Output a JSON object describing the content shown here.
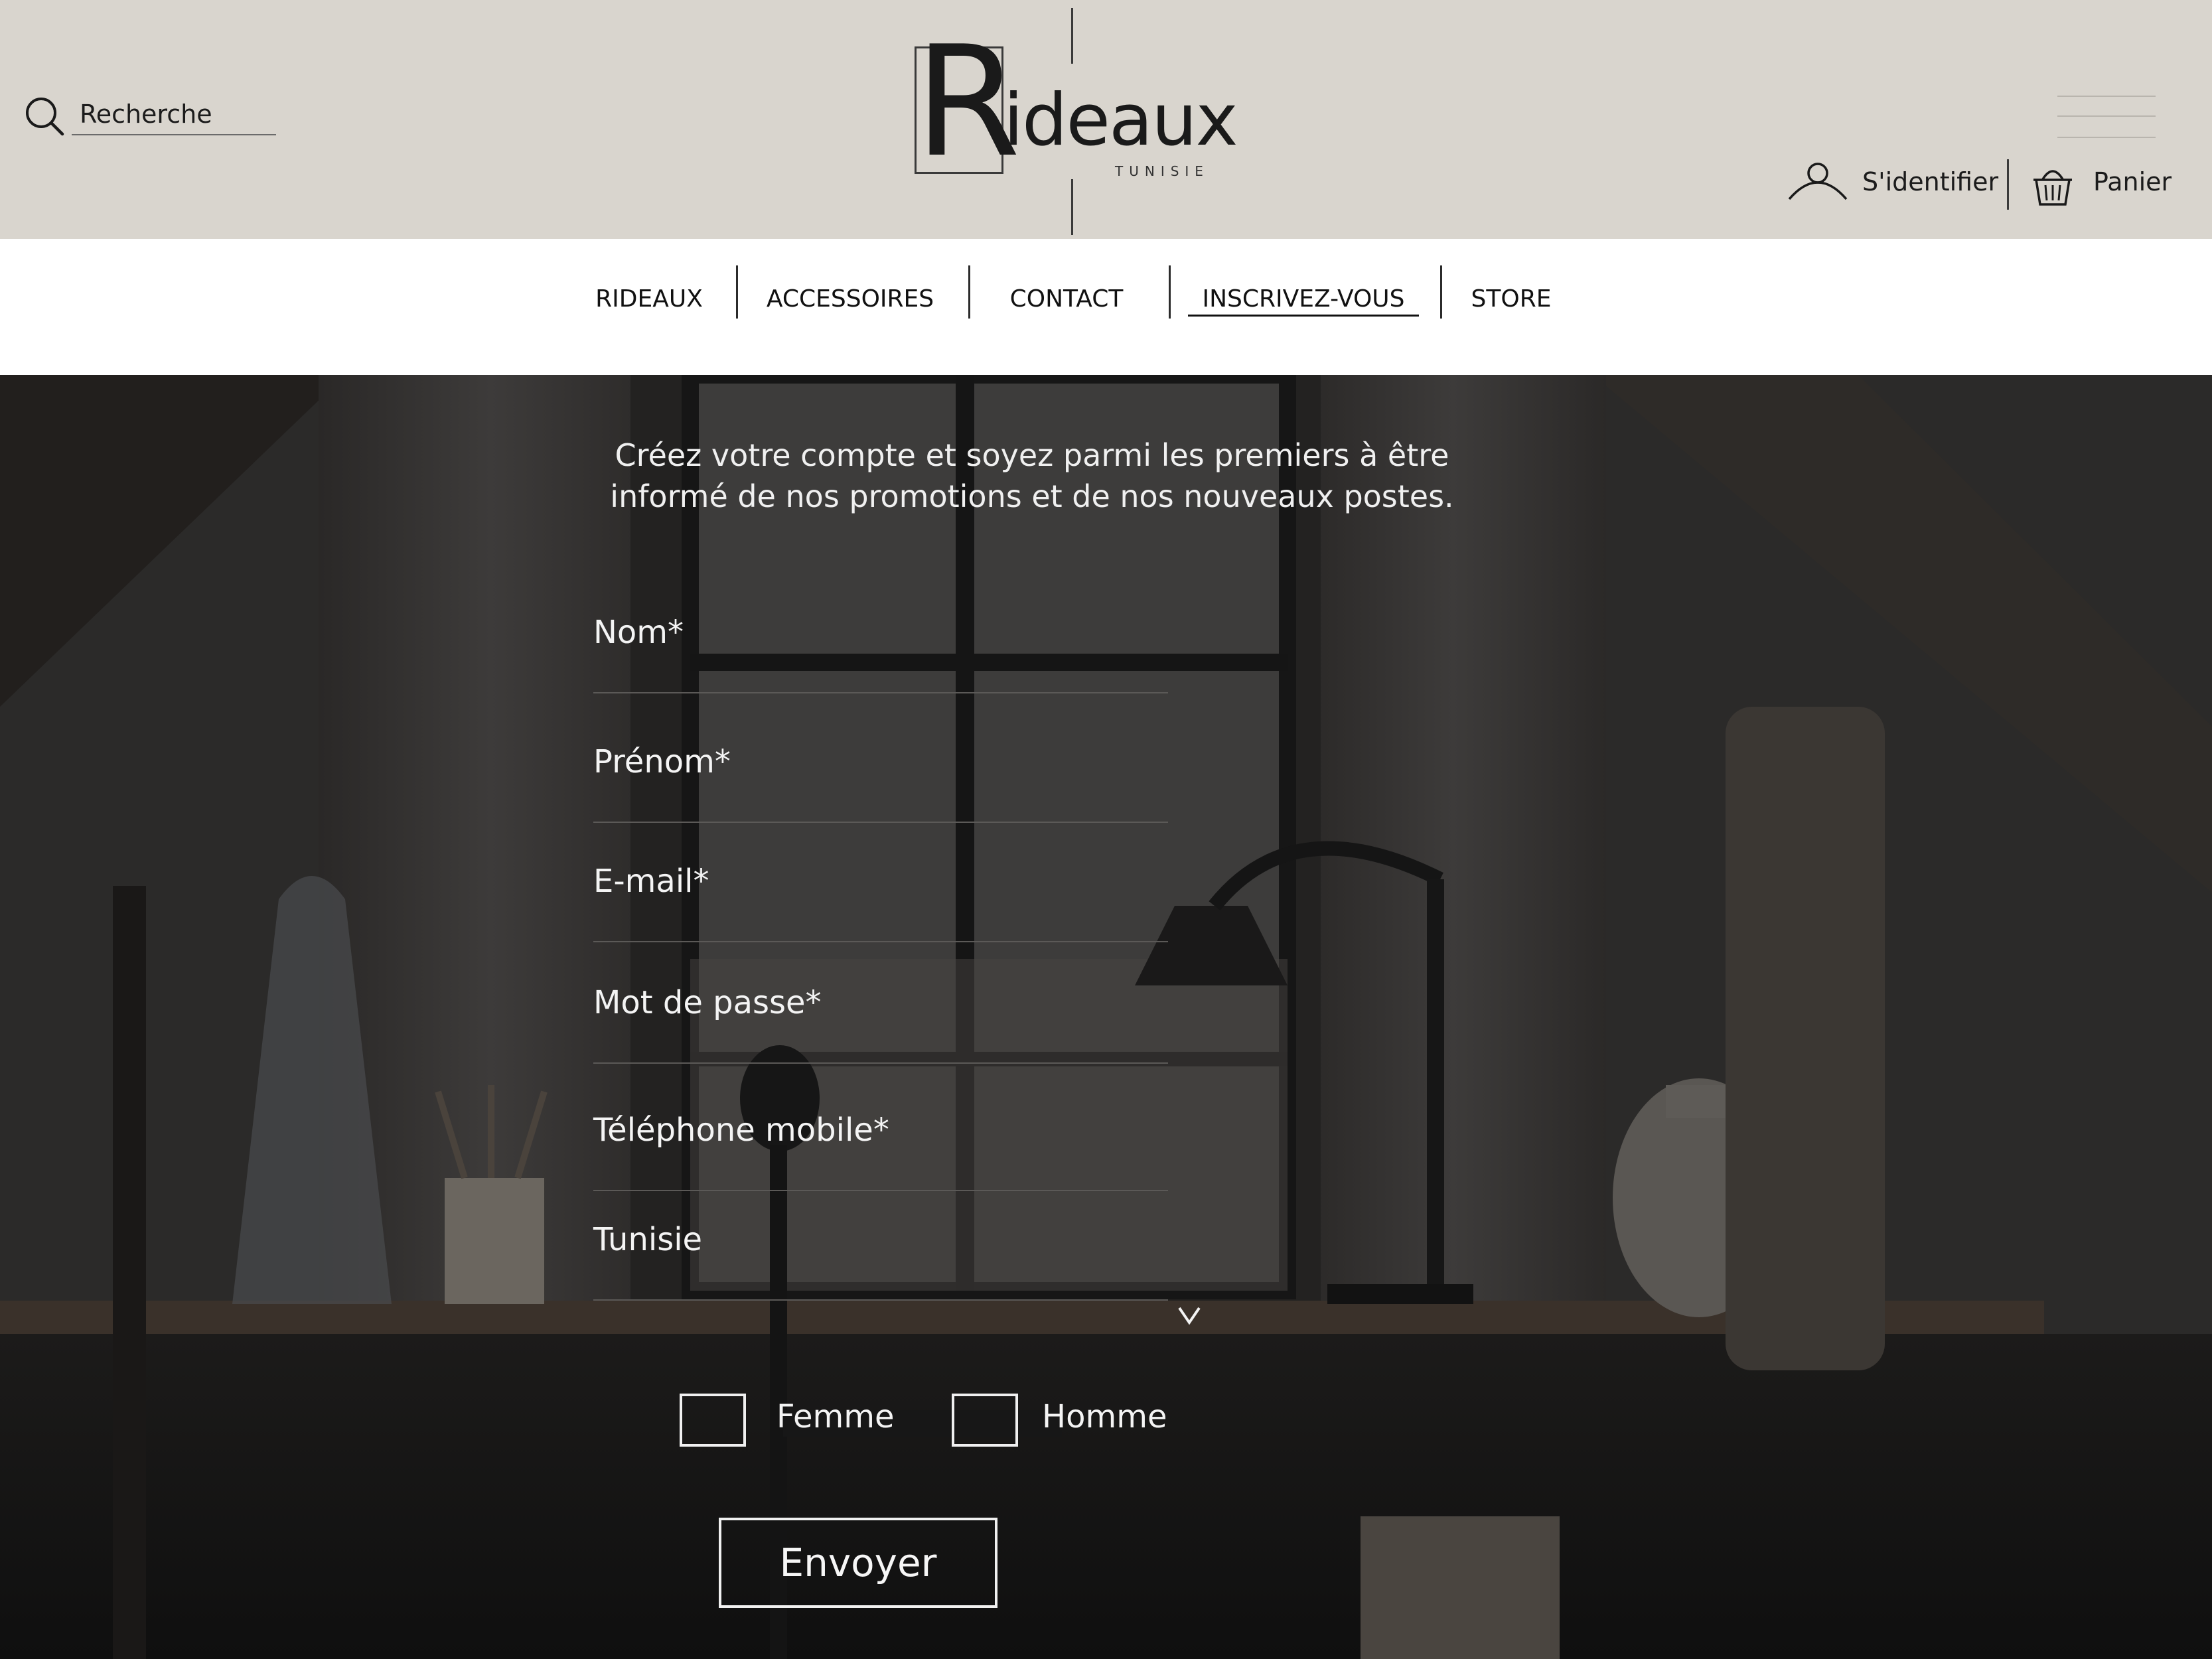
{
  "header": {
    "search": {
      "label": "Recherche"
    },
    "logo": {
      "initial": "R",
      "rest": "ideaux",
      "subtitle": "TUNISIE"
    },
    "signin_label": "S'identifier",
    "cart_label": "Panier"
  },
  "nav": {
    "items": [
      {
        "label": "RIDEAUX"
      },
      {
        "label": "ACCESSOIRES"
      },
      {
        "label": "CONTACT"
      },
      {
        "label": "INSCRIVEZ-VOUS",
        "active": true
      },
      {
        "label": "STORE"
      }
    ]
  },
  "form": {
    "intro_line1": "Créez votre compte et soyez parmi les premiers à être",
    "intro_line2": "informé de nos promotions et de nos nouveaux postes.",
    "fields": [
      {
        "label": "Nom*"
      },
      {
        "label": "Prénom*"
      },
      {
        "label": "E-mail*"
      },
      {
        "label": "Mot de passe*"
      },
      {
        "label": "Téléphone mobile*"
      }
    ],
    "country": {
      "value": "Tunisie"
    },
    "gender": {
      "female": "Femme",
      "male": "Homme"
    },
    "submit_label": "Envoyer"
  },
  "icons": {
    "search": "search-icon",
    "user": "user-icon",
    "cart": "basket-icon",
    "menu": "hamburger-menu-icon",
    "dropdown": "chevron-down-icon"
  },
  "colors": {
    "header_bg": "#d9d5ce",
    "nav_bg": "#ffffff",
    "hero_overlay": "#2a2827",
    "text_light": "#f4f4f4"
  }
}
